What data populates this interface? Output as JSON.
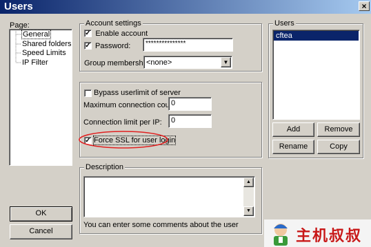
{
  "window": {
    "title": "Users",
    "close": "×"
  },
  "page_panel": {
    "label": "Page:",
    "items": [
      "General",
      "Shared folders",
      "Speed Limits",
      "IP Filter"
    ],
    "selected": "General"
  },
  "account_settings": {
    "label": "Account settings",
    "enable_account": {
      "label": "Enable account",
      "checked": true
    },
    "password": {
      "label": "Password:",
      "checked": true,
      "value": "***************"
    },
    "group_membership": {
      "label": "Group membership:",
      "value": "<none>"
    }
  },
  "limits": {
    "bypass": {
      "label": "Bypass userlimit of server",
      "checked": false
    },
    "max_conn": {
      "label": "Maximum connection count:",
      "value": "0"
    },
    "conn_per_ip": {
      "label": "Connection limit per IP:",
      "value": "0"
    },
    "force_ssl": {
      "label": "Force SSL for user login",
      "checked": true
    }
  },
  "description": {
    "label": "Description",
    "value": "",
    "hint": "You can enter some comments about the user"
  },
  "users_panel": {
    "label": "Users",
    "list": [
      "cftea"
    ],
    "selected": "cftea",
    "add": "Add",
    "remove": "Remove",
    "rename": "Rename",
    "copy": "Copy"
  },
  "buttons": {
    "ok": "OK",
    "cancel": "Cancel"
  },
  "watermark": {
    "text": "主机叔叔"
  },
  "colors": {
    "title_start": "#0a246a",
    "title_end": "#a6caf0",
    "selection": "#0a246a",
    "highlight_ring": "#e02020"
  }
}
